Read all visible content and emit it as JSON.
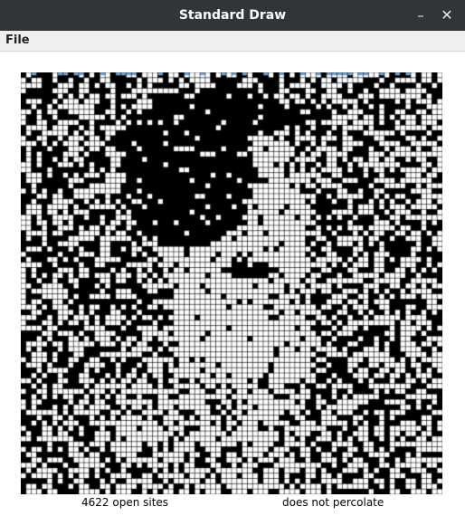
{
  "window": {
    "title": "Standard Draw",
    "minimize_glyph": "–",
    "close_glyph": "✕"
  },
  "menu": {
    "items": [
      "File"
    ]
  },
  "percolation": {
    "grid_size": 80,
    "open_sites_text": "4622 open sites",
    "status_text": "does not percolate",
    "colors": {
      "blocked": "#000000",
      "open": "#ffffff",
      "full": "#6fa8dc",
      "grid_line": "#000000"
    }
  }
}
